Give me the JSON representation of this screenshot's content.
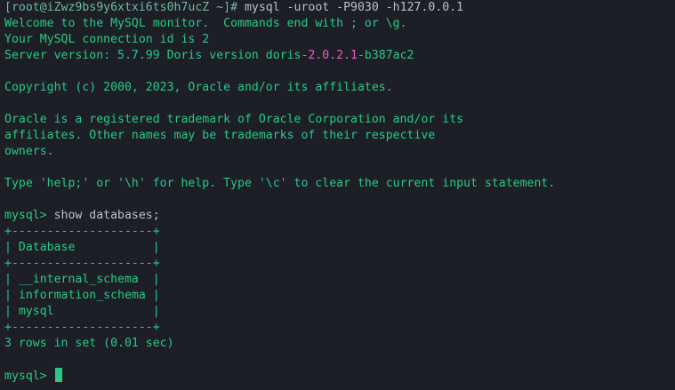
{
  "shell": {
    "prompt": "[root@iZwz9bs9y6xtxi6ts0h7ucZ ~]#",
    "command": " mysql -uroot -P9030 -h127.0.0.1"
  },
  "banner": {
    "welcome": "Welcome to the MySQL monitor.  Commands end with ; or \\g.",
    "connection": "Your MySQL connection id is 2",
    "version_prefix": "Server version: 5.7.99 Doris version doris-",
    "version_number": "2.0.2.1",
    "version_suffix": "-b387ac2",
    "copyright": "Copyright (c) 2000, 2023, Oracle and/or its affiliates.",
    "trademark_1": "Oracle is a registered trademark of Oracle Corporation and/or its",
    "trademark_2": "affiliates. Other names may be trademarks of their respective",
    "trademark_3": "owners.",
    "help": "Type 'help;' or '\\h' for help. Type '\\c' to clear the current input statement."
  },
  "query": {
    "prompt": "mysql>",
    "command": " show databases;"
  },
  "result": {
    "border": "+--------------------+",
    "header": "| Database           |",
    "rows": [
      "| __internal_schema  |",
      "| information_schema |",
      "| mysql              |"
    ],
    "summary": "3 rows in set (0.01 sec)"
  },
  "current": {
    "prompt": "mysql>",
    "input": " "
  },
  "colors": {
    "background": "#1e1f26",
    "text": "#28c984",
    "version_highlight": "#e060c0"
  }
}
